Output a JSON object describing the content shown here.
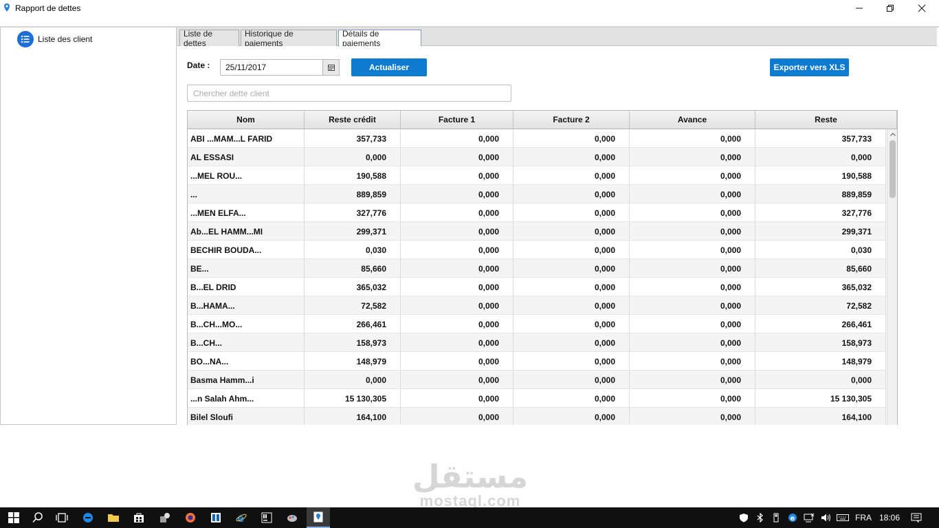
{
  "window": {
    "title": "Rapport de dettes"
  },
  "sidebar": {
    "items": [
      {
        "label": "Liste des client",
        "icon": "list-icon"
      }
    ]
  },
  "tabs": [
    {
      "label": "Liste de dettes",
      "active": false
    },
    {
      "label": "Historique de paiements",
      "active": false
    },
    {
      "label": "Détails de paiements",
      "active": true
    }
  ],
  "toolbar": {
    "date_label": "Date :",
    "date_value": "25/11/2017",
    "refresh_label": "Actualiser",
    "export_label": "Exporter vers XLS",
    "search_placeholder": "Chercher dette client",
    "accent_color": "#0f7bd0"
  },
  "table": {
    "columns": [
      "Nom",
      "Reste crédit",
      "Facture 1",
      "Facture 2",
      "Avance",
      "Reste"
    ],
    "rows": [
      [
        "ABI ...MAM...L FARID",
        "357,733",
        "0,000",
        "0,000",
        "0,000",
        "357,733"
      ],
      [
        "AL ESSASI",
        "0,000",
        "0,000",
        "0,000",
        "0,000",
        "0,000"
      ],
      [
        "...MEL ROU...",
        "190,588",
        "0,000",
        "0,000",
        "0,000",
        "190,588"
      ],
      [
        "...",
        "889,859",
        "0,000",
        "0,000",
        "0,000",
        "889,859"
      ],
      [
        "...MEN ELFA...",
        "327,776",
        "0,000",
        "0,000",
        "0,000",
        "327,776"
      ],
      [
        "Ab...EL HAMM...MI",
        "299,371",
        "0,000",
        "0,000",
        "0,000",
        "299,371"
      ],
      [
        "BECHIR BOUDA...",
        "0,030",
        "0,000",
        "0,000",
        "0,000",
        "0,030"
      ],
      [
        "BE...",
        "85,660",
        "0,000",
        "0,000",
        "0,000",
        "85,660"
      ],
      [
        "B...EL DRID",
        "365,032",
        "0,000",
        "0,000",
        "0,000",
        "365,032"
      ],
      [
        "B...HAMA...",
        "72,582",
        "0,000",
        "0,000",
        "0,000",
        "72,582"
      ],
      [
        "B...CH...MO...",
        "266,461",
        "0,000",
        "0,000",
        "0,000",
        "266,461"
      ],
      [
        "B...CH...",
        "158,973",
        "0,000",
        "0,000",
        "0,000",
        "158,973"
      ],
      [
        "BO...NA...",
        "148,979",
        "0,000",
        "0,000",
        "0,000",
        "148,979"
      ],
      [
        "Basma Hamm...i",
        "0,000",
        "0,000",
        "0,000",
        "0,000",
        "0,000"
      ],
      [
        "...n Salah Ahm...",
        "15 130,305",
        "0,000",
        "0,000",
        "0,000",
        "15 130,305"
      ],
      [
        "Bilel Sloufi",
        "164,100",
        "0,000",
        "0,000",
        "0,000",
        "164,100"
      ]
    ]
  },
  "watermark": {
    "arabic": "مستقل",
    "latin": "mostaql.com"
  },
  "taskbar": {
    "language": "FRA",
    "time": "18:06"
  }
}
